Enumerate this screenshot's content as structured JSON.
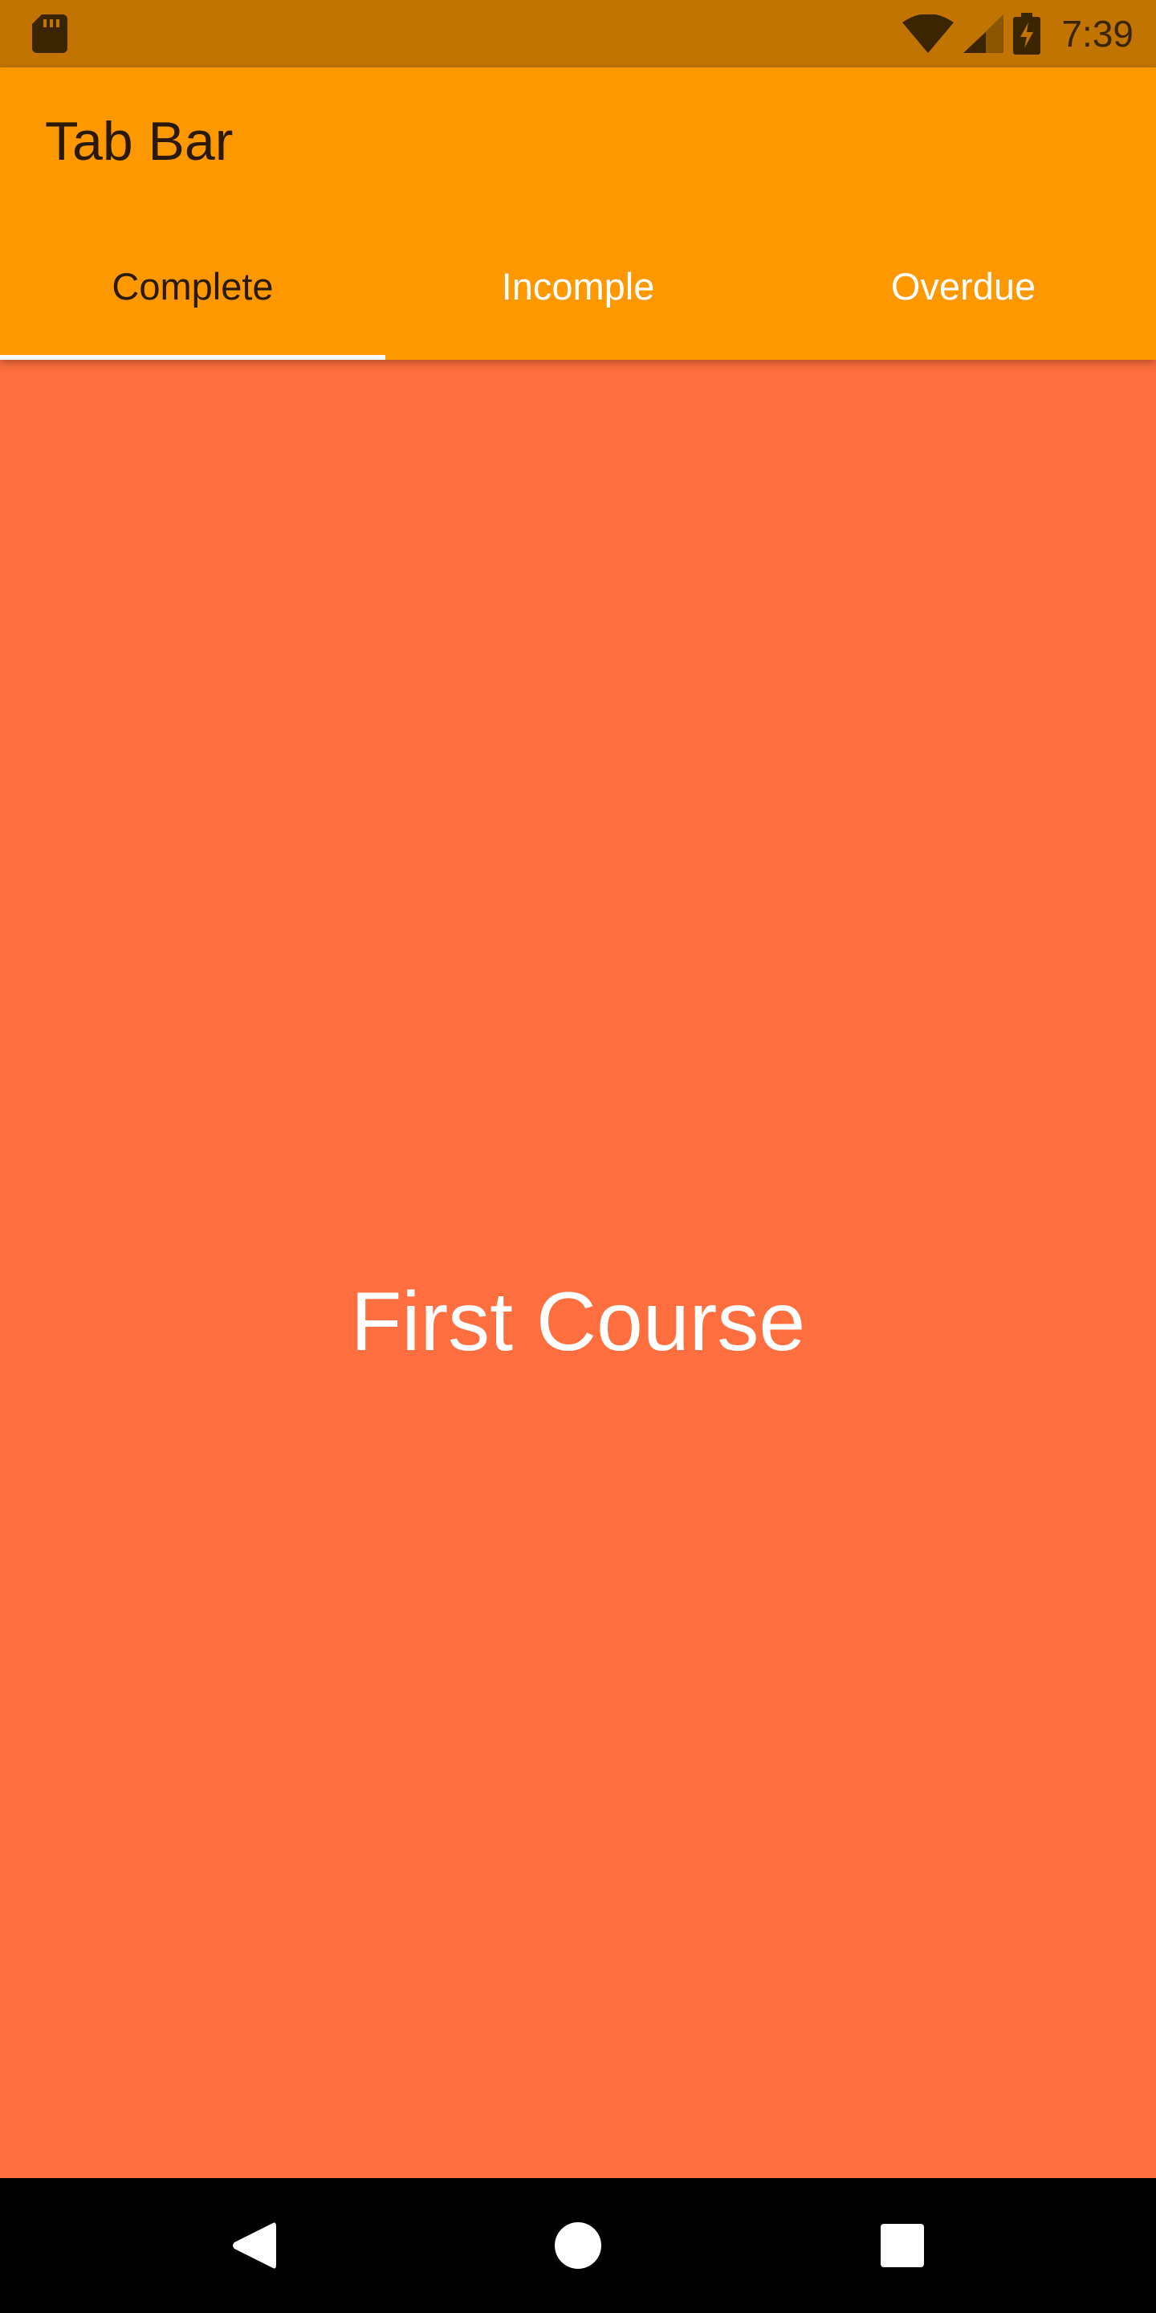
{
  "status_bar": {
    "time": "7:39",
    "icons": [
      "sd-card-icon",
      "wifi-icon",
      "signal-icon",
      "battery-charging-icon"
    ]
  },
  "app_bar": {
    "title": "Tab Bar"
  },
  "tabs": [
    {
      "label": "Complete",
      "active": true
    },
    {
      "label": "Incomple",
      "active": false
    },
    {
      "label": "Overdue",
      "active": false
    }
  ],
  "content": {
    "text": "First Course"
  },
  "nav_bar": {
    "buttons": [
      "back-icon",
      "home-icon",
      "recents-icon"
    ]
  },
  "colors": {
    "status_bar": "#c17400",
    "app_bar": "#fe9800",
    "content_background": "#fe6e3e",
    "tab_indicator": "#ffffff",
    "nav_bar": "#000000"
  }
}
